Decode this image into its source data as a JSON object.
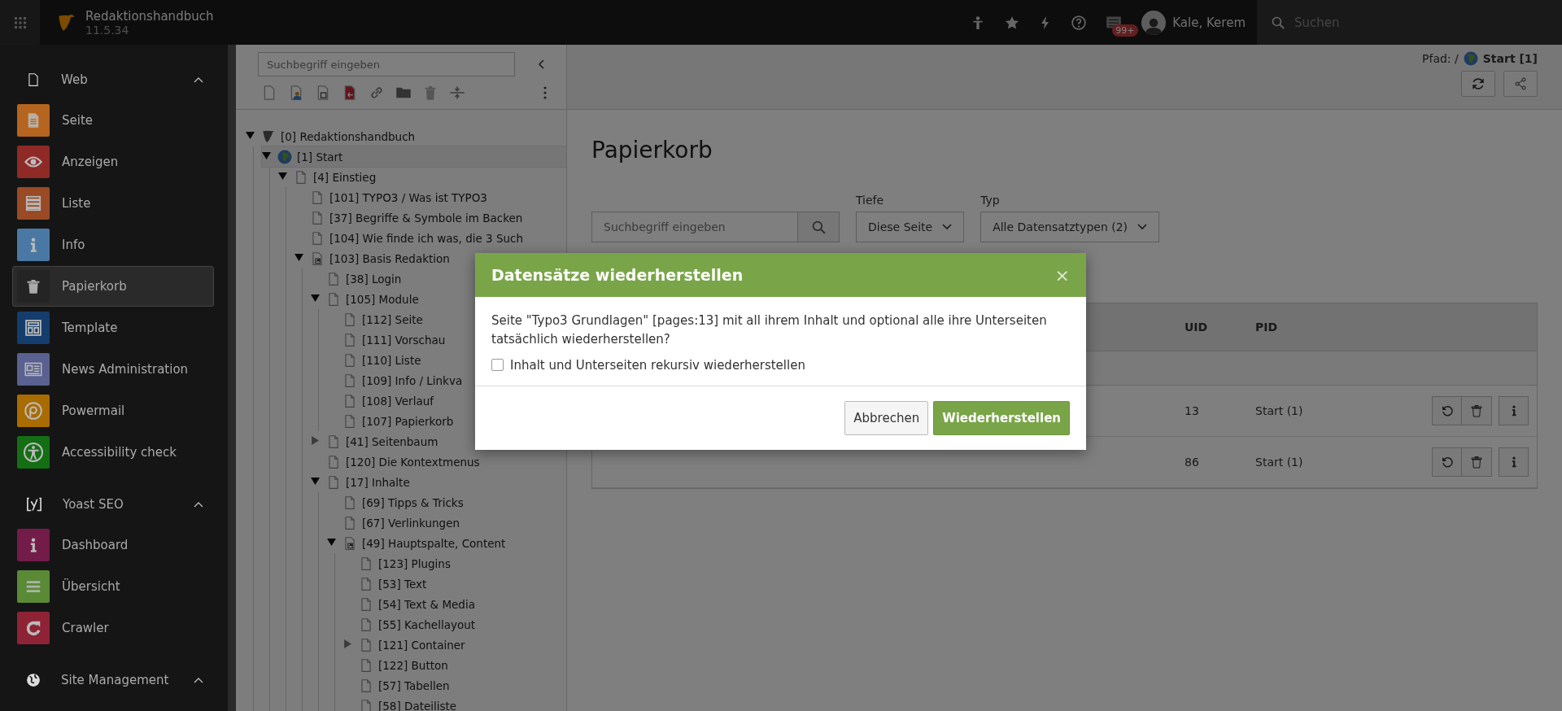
{
  "topbar": {
    "site_name": "Redaktionshandbuch",
    "version": "11.5.34",
    "notification_badge": "99+",
    "user_name": "Kale, Kerem",
    "search": {
      "placeholder": "Suchen"
    }
  },
  "sidebar": {
    "groups": [
      {
        "label": "Web",
        "expanded": true,
        "items": [
          {
            "label": "Seite",
            "color": "#b5651f",
            "selected": false
          },
          {
            "label": "Anzeigen",
            "color": "#8f2a26",
            "selected": false
          },
          {
            "label": "Liste",
            "color": "#9a4a24",
            "selected": false
          },
          {
            "label": "Info",
            "color": "#4a78a4",
            "selected": false
          },
          {
            "label": "Papierkorb",
            "color": "#242424",
            "selected": true
          },
          {
            "label": "Template",
            "color": "#143d6e",
            "selected": false
          },
          {
            "label": "News Administration",
            "color": "#5a608f",
            "selected": false
          },
          {
            "label": "Powermail",
            "color": "#a86c00",
            "selected": false
          },
          {
            "label": "Accessibility check",
            "color": "#146e14",
            "selected": false
          }
        ]
      },
      {
        "label": "Yoast SEO",
        "expanded": true,
        "items": [
          {
            "label": "Dashboard",
            "color": "#731c4a",
            "selected": false
          },
          {
            "label": "Übersicht",
            "color": "#5a8a36",
            "selected": false
          },
          {
            "label": "Crawler",
            "color": "#8e2336",
            "selected": false
          }
        ]
      },
      {
        "label": "Site Management",
        "expanded": true
      }
    ]
  },
  "page_tree": {
    "search": {
      "placeholder": "Suchbegriff eingeben"
    },
    "nodes": [
      {
        "label": "[0] Redaktionshandbuch",
        "kind": "root",
        "expanded": true,
        "selected": false,
        "children": [
          {
            "label": "[1] Start",
            "kind": "site",
            "expanded": true,
            "selected": true,
            "children": [
              {
                "label": "[4] Einstieg",
                "kind": "page",
                "expanded": true,
                "selected": false,
                "children": [
                  {
                    "label": "[101] TYPO3 / Was ist TYPO3",
                    "kind": "page",
                    "selected": false
                  },
                  {
                    "label": "[37] Begriffe & Symbole im Backen",
                    "kind": "page",
                    "selected": false
                  },
                  {
                    "label": "[104] Wie finde ich was, die 3 Such",
                    "kind": "page",
                    "selected": false
                  },
                  {
                    "label": "[103] Basis Redaktion",
                    "kind": "shortcut",
                    "expanded": true,
                    "selected": false,
                    "children": [
                      {
                        "label": "[38] Login",
                        "kind": "page",
                        "selected": false
                      },
                      {
                        "label": "[105] Module",
                        "kind": "page",
                        "expanded": true,
                        "selected": false,
                        "children": [
                          {
                            "label": "[112] Seite",
                            "kind": "page",
                            "selected": false
                          },
                          {
                            "label": "[111] Vorschau",
                            "kind": "page",
                            "selected": false
                          },
                          {
                            "label": "[110] Liste",
                            "kind": "page",
                            "selected": false
                          },
                          {
                            "label": "[109] Info / Linkva",
                            "kind": "page",
                            "selected": false
                          },
                          {
                            "label": "[108] Verlauf",
                            "kind": "page",
                            "selected": false
                          },
                          {
                            "label": "[107] Papierkorb",
                            "kind": "page",
                            "selected": false
                          }
                        ]
                      },
                      {
                        "label": "[41] Seitenbaum",
                        "kind": "page",
                        "expanded": false,
                        "selected": false
                      },
                      {
                        "label": "[120] Die Kontextmenus",
                        "kind": "page",
                        "selected": false
                      },
                      {
                        "label": "[17] Inhalte",
                        "kind": "page",
                        "expanded": true,
                        "selected": false,
                        "children": [
                          {
                            "label": "[69] Tipps & Tricks",
                            "kind": "page",
                            "selected": false
                          },
                          {
                            "label": "[67] Verlinkungen",
                            "kind": "page",
                            "selected": false
                          },
                          {
                            "label": "[49] Hauptspalte, Content",
                            "kind": "shortcut",
                            "expanded": true,
                            "selected": false,
                            "children": [
                              {
                                "label": "[123] Plugins",
                                "kind": "page",
                                "selected": false
                              },
                              {
                                "label": "[53] Text",
                                "kind": "page",
                                "selected": false
                              },
                              {
                                "label": "[54] Text & Media",
                                "kind": "page",
                                "selected": false
                              },
                              {
                                "label": "[55] Kachellayout",
                                "kind": "page",
                                "selected": false
                              },
                              {
                                "label": "[121] Container",
                                "kind": "page",
                                "expanded": false,
                                "selected": false
                              },
                              {
                                "label": "[122] Button",
                                "kind": "page",
                                "selected": false
                              },
                              {
                                "label": "[57] Tabellen",
                                "kind": "page",
                                "selected": false
                              },
                              {
                                "label": "[58] Dateiliste",
                                "kind": "page",
                                "selected": false
                              }
                            ]
                          }
                        ]
                      }
                    ]
                  }
                ]
              }
            ]
          }
        ]
      }
    ]
  },
  "main": {
    "path_label": "Pfad: /",
    "path_page": "Start [1]",
    "title": "Papierkorb",
    "search": {
      "placeholder": "Suchbegriff eingeben"
    },
    "depth_filter": {
      "label": "Tiefe",
      "value": "Diese Seite"
    },
    "type_filter": {
      "label": "Typ",
      "value": "Alle Datensatztypen (2)"
    },
    "table": {
      "columns": [
        "UID",
        "PID"
      ],
      "rows": [
        {
          "uid": "13",
          "pid": "Start (1)"
        },
        {
          "uid": "86",
          "pid": "Start (1)"
        }
      ]
    }
  },
  "dialog": {
    "title": "Datensätze wiederherstellen",
    "close": "×",
    "message": "Seite \"Typo3 Grundlagen\" [pages:13] mit all ihrem Inhalt und optional alle ihre Unterseiten tatsächlich wiederherstellen?",
    "checkbox": {
      "label": "Inhalt und Unterseiten rekursiv wiederherstellen",
      "checked": false
    },
    "buttons": [
      {
        "label": "Abbrechen",
        "kind": "default"
      },
      {
        "label": "Wiederherstellen",
        "kind": "primary"
      }
    ]
  }
}
